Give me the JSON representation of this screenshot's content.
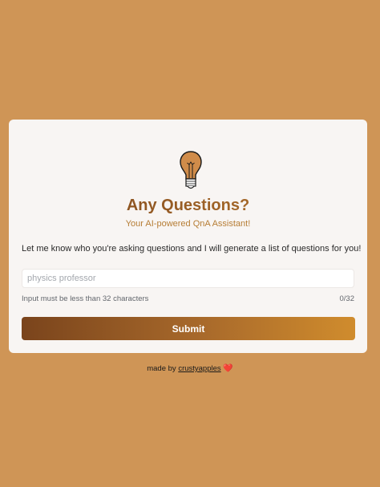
{
  "app": {
    "title": "Any Questions?",
    "subtitle": "Your AI-powered QnA Assistant!",
    "description": "Let me know who you're asking questions and I will generate a list of questions for you!"
  },
  "form": {
    "input_value": "",
    "input_placeholder": "physics professor",
    "hint": "Input must be less than 32 characters",
    "counter": "0/32",
    "submit_label": "Submit"
  },
  "footer": {
    "made_by": "made by",
    "author": "crustyapples",
    "heart": "❤️"
  },
  "icons": {
    "logo": "lightbulb-icon",
    "footer_heart": "heart-icon"
  },
  "colors": {
    "background": "#CF9556",
    "accent_dark": "#7A441C",
    "accent_light": "#D08C2D",
    "card": "#F8F5F3"
  }
}
